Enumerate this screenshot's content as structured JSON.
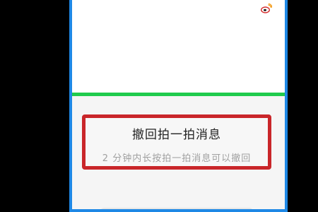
{
  "action": {
    "title": "撤回拍一拍消息",
    "subtitle": "2 分钟内长按拍一拍消息可以撤回"
  },
  "icons": {
    "top_right": "weibo-icon"
  },
  "colors": {
    "frame_border": "#1e88e5",
    "divider": "#1fcb4d",
    "highlight_box": "#c9262a",
    "background": "#000000"
  }
}
